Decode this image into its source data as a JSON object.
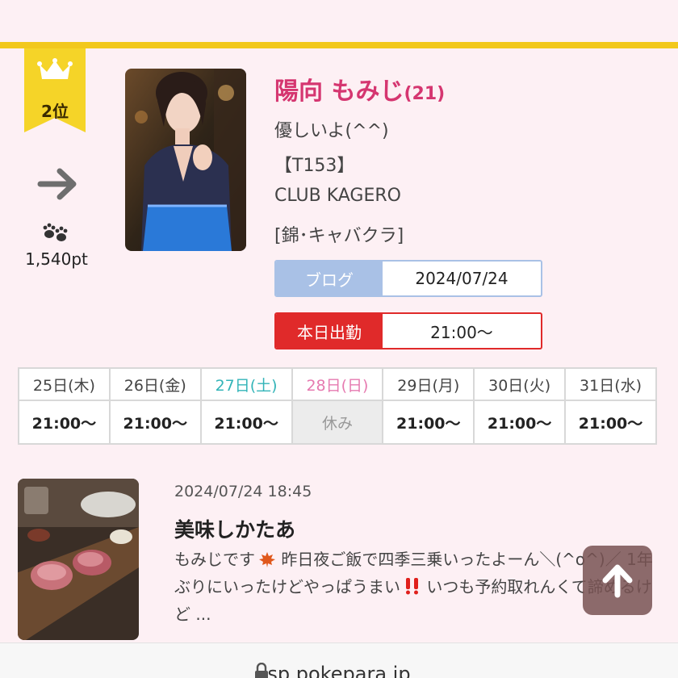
{
  "ranking": {
    "rank_label": "2位",
    "trend": "flat",
    "points": "1,540pt"
  },
  "profile": {
    "name": "陽向 もみじ",
    "age": "(21)",
    "catchphrase": "優しいよ(^^)",
    "height": "【T153】",
    "club": "CLUB KAGERO",
    "area": "[錦･キャバクラ]"
  },
  "blog_pill": {
    "label": "ブログ",
    "value": "2024/07/24"
  },
  "work_pill": {
    "label": "本日出勤",
    "value": "21:00〜"
  },
  "schedule": {
    "days": [
      "25日(木)",
      "26日(金)",
      "27日(土)",
      "28日(日)",
      "29日(月)",
      "30日(火)",
      "31日(水)"
    ],
    "times": [
      "21:00〜",
      "21:00〜",
      "21:00〜",
      "休み",
      "21:00〜",
      "21:00〜",
      "21:00〜"
    ]
  },
  "blog_post": {
    "date": "2024/07/24 18:45",
    "title": "美味しかたあ",
    "excerpt_1": "もみじです",
    "excerpt_2": " 昨日夜ご飯で四季三乗いったよーん＼(^o^)／ 1年ぶりにいったけどやっぱうまい",
    "excerpt_3": " いつも予約取れんくて諦めるけど ..."
  },
  "browser": {
    "url": "sp.pokepara.jp"
  },
  "colors": {
    "accent_gold": "#f2c81c",
    "name_pink": "#d53670",
    "blog_blue": "#a9c1e6",
    "work_red": "#e02a2a",
    "saturday": "#33b4b8",
    "sunday": "#e67ab0"
  },
  "icons": {
    "rank": "crown-icon",
    "trend": "arrow-right-icon",
    "points": "paw-icon",
    "excerpt_leaf": "maple-leaf-icon",
    "excerpt_mark": "double-exclamation-icon",
    "scroll": "arrow-up-icon",
    "url": "lock-icon"
  }
}
